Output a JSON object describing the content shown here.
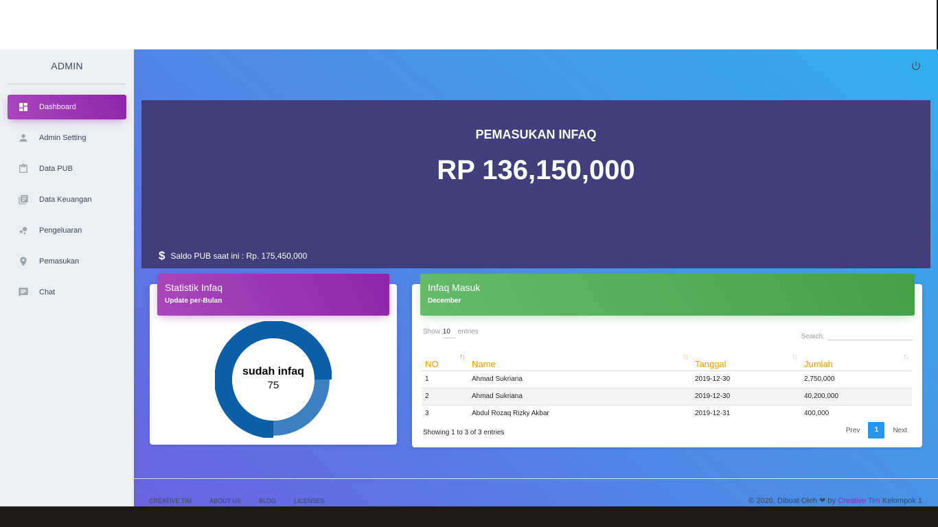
{
  "sidebar": {
    "brand": "ADMIN",
    "items": [
      {
        "label": "Dashboard",
        "icon": "dashboard-icon",
        "active": true
      },
      {
        "label": "Admin Setting",
        "icon": "person-icon"
      },
      {
        "label": "Data PUB",
        "icon": "clipboard-icon"
      },
      {
        "label": "Data Keuangan",
        "icon": "library-books-icon"
      },
      {
        "label": "Pengeluaran",
        "icon": "bubble-chart-icon"
      },
      {
        "label": "Pemasukan",
        "icon": "location-pin-icon"
      },
      {
        "label": "Chat",
        "icon": "chat-icon"
      }
    ]
  },
  "header": {
    "power_icon": "power-icon"
  },
  "hero": {
    "title": "PEMASUKAN INFAQ",
    "value": "RP 136,150,000",
    "footer_symbol": "$",
    "footer_text": "Saldo PUB saat ini : Rp. 175,450,000"
  },
  "stat_card": {
    "title": "Statistik Infaq",
    "subtitle": "Update per-Bulan",
    "donut_label": "sudah infaq",
    "donut_value": "75",
    "donut_fraction": 0.75,
    "colors": {
      "primary": "#0c5fa6",
      "secondary": "#3b80c1"
    }
  },
  "infaq_card": {
    "title": "Infaq Masuk",
    "subtitle": "December",
    "show_label": "Show",
    "show_value": "10",
    "entries_label": "entries",
    "search_label": "Search:",
    "columns": [
      "NO",
      "Name",
      "Tanggal",
      "Jumlah"
    ],
    "rows": [
      {
        "no": "1",
        "name": "Ahmad Sukriana",
        "date": "2019-12-30",
        "amount": "2,750,000"
      },
      {
        "no": "2",
        "name": "Ahmad Sukriana",
        "date": "2019-12-30",
        "amount": "40,200,000"
      },
      {
        "no": "3",
        "name": "Abdul Rozaq Rizky Akbar",
        "date": "2019-12-31",
        "amount": "400,000"
      }
    ],
    "info": "Showing 1 to 3 of 3 entries",
    "prev": "Prev",
    "page": "1",
    "next": "Next"
  },
  "footer": {
    "links": [
      "CREATIVE TIM",
      "ABOUT US",
      "BLOG",
      "LICENSES"
    ],
    "copy_prefix": "© 2020, Dibuat Oleh",
    "heart": "❤",
    "copy_by": "by",
    "copy_brand": "Creative Tim",
    "copy_suffix": "Kelompok 1"
  },
  "colors": {
    "accent_purple": "#9c27b0",
    "accent_green": "#4caf50",
    "hero_bg": "#413e7b",
    "table_header": "#ff9800",
    "page_active": "#2196f3"
  }
}
